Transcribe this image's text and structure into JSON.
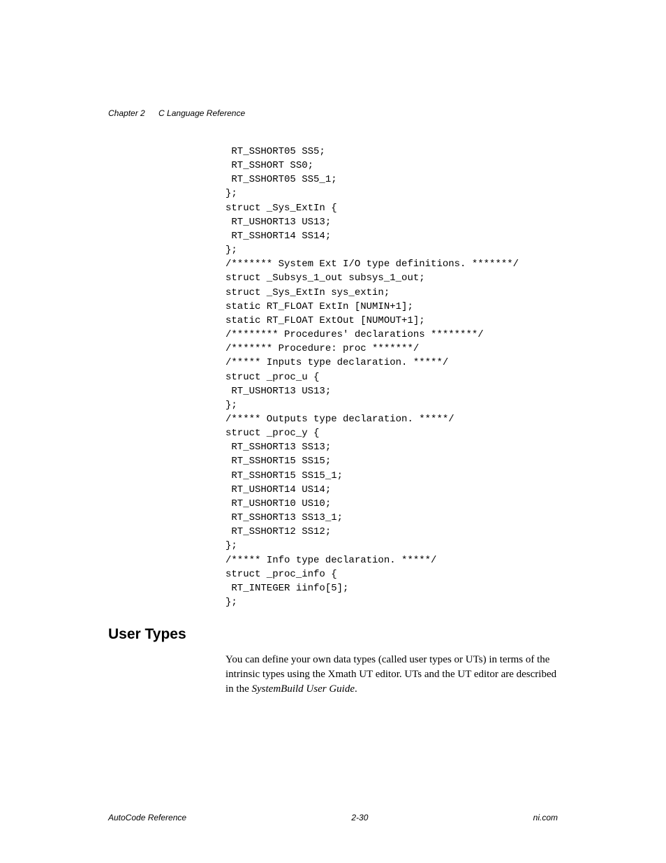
{
  "header": {
    "chapter": "Chapter 2",
    "title": "C Language Reference"
  },
  "code": " RT_SSHORT05 SS5;\n RT_SSHORT SS0;\n RT_SSHORT05 SS5_1;\n};\nstruct _Sys_ExtIn {\n RT_USHORT13 US13;\n RT_SSHORT14 SS14;\n};\n/******* System Ext I/O type definitions. *******/\nstruct _Subsys_1_out subsys_1_out;\nstruct _Sys_ExtIn sys_extin;\nstatic RT_FLOAT ExtIn [NUMIN+1];\nstatic RT_FLOAT ExtOut [NUMOUT+1];\n/******** Procedures' declarations ********/\n/******* Procedure: proc *******/\n/***** Inputs type declaration. *****/\nstruct _proc_u {\n RT_USHORT13 US13;\n};\n/***** Outputs type declaration. *****/\nstruct _proc_y {\n RT_SSHORT13 SS13;\n RT_SSHORT15 SS15;\n RT_SSHORT15 SS15_1;\n RT_USHORT14 US14;\n RT_USHORT10 US10;\n RT_SSHORT13 SS13_1;\n RT_SSHORT12 SS12;\n};\n/***** Info type declaration. *****/\nstruct _proc_info {\n RT_INTEGER iinfo[5];\n};",
  "section": {
    "heading": "User Types",
    "body_pre": "You can define your own data types (called user types or UTs) in terms of the intrinsic types using the Xmath UT editor. UTs and the UT editor are described in the ",
    "body_em": "SystemBuild User Guide",
    "body_post": "."
  },
  "footer": {
    "left": "AutoCode Reference",
    "center": "2-30",
    "right": "ni.com"
  }
}
